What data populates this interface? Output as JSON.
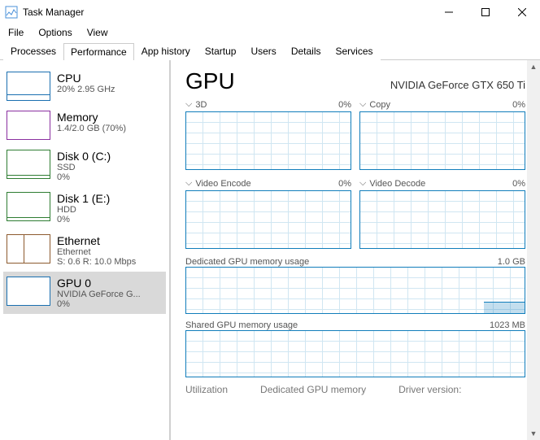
{
  "window": {
    "title": "Task Manager"
  },
  "menu": {
    "file": "File",
    "options": "Options",
    "view": "View"
  },
  "tabs": {
    "processes": "Processes",
    "performance": "Performance",
    "apphistory": "App history",
    "startup": "Startup",
    "users": "Users",
    "details": "Details",
    "services": "Services"
  },
  "sidebar": {
    "cpu": {
      "name": "CPU",
      "sub1": "20% 2.95 GHz"
    },
    "memory": {
      "name": "Memory",
      "sub1": "1.4/2.0 GB (70%)"
    },
    "disk0": {
      "name": "Disk 0 (C:)",
      "sub1": "SSD",
      "sub2": "0%"
    },
    "disk1": {
      "name": "Disk 1 (E:)",
      "sub1": "HDD",
      "sub2": "0%"
    },
    "eth": {
      "name": "Ethernet",
      "sub1": "Ethernet",
      "sub2": "S: 0.6 R: 10.0 Mbps"
    },
    "gpu": {
      "name": "GPU 0",
      "sub1": "NVIDIA GeForce G...",
      "sub2": "0%"
    }
  },
  "content": {
    "title": "GPU",
    "device": "NVIDIA GeForce GTX 650 Ti",
    "g1": {
      "label": "3D",
      "pct": "0%"
    },
    "g2": {
      "label": "Copy",
      "pct": "0%"
    },
    "g3": {
      "label": "Video Encode",
      "pct": "0%"
    },
    "g4": {
      "label": "Video Decode",
      "pct": "0%"
    },
    "dedmem": {
      "label": "Dedicated GPU memory usage",
      "max": "1.0 GB"
    },
    "shmem": {
      "label": "Shared GPU memory usage",
      "max": "1023 MB"
    },
    "stats": {
      "util": "Utilization",
      "ded": "Dedicated GPU memory",
      "drv": "Driver version:"
    }
  }
}
